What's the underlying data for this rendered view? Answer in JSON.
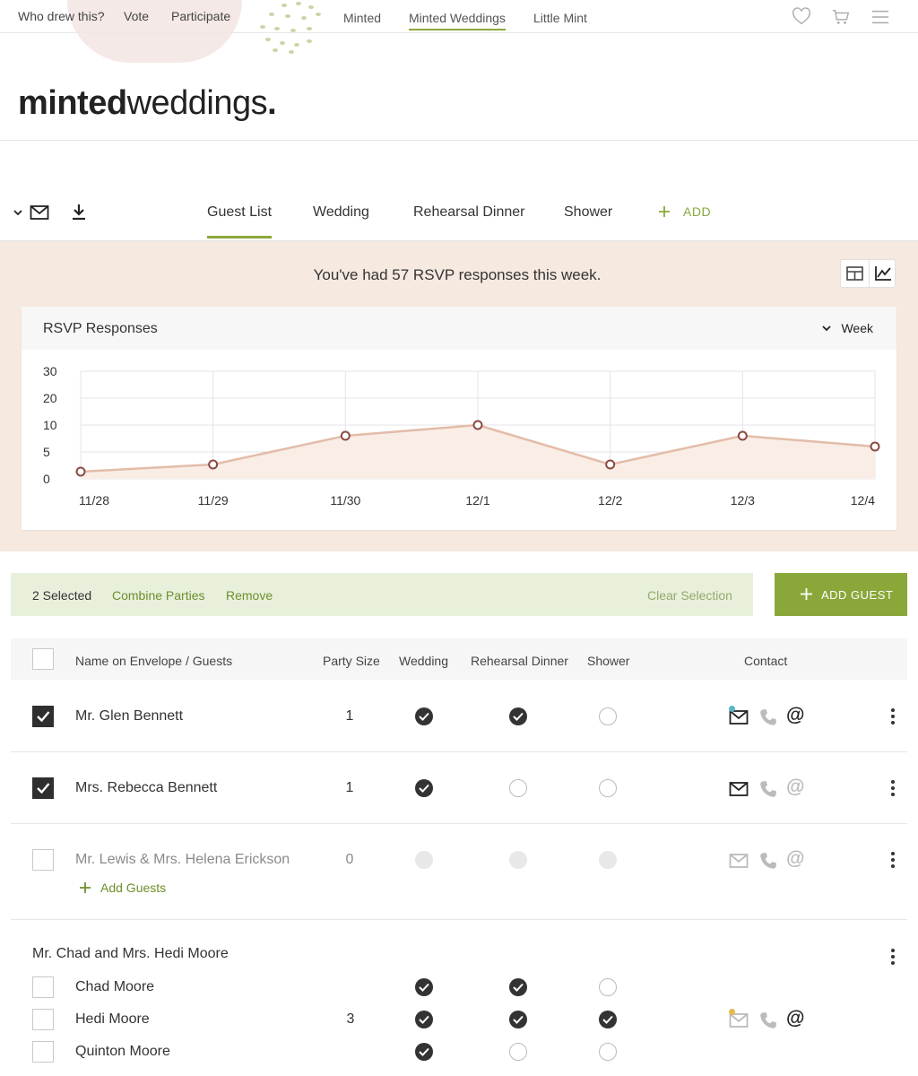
{
  "topbar": {
    "left_links": [
      "Who drew this?",
      "Vote",
      "Participate"
    ],
    "center_links": [
      "Minted",
      "Minted Weddings",
      "Little Mint"
    ],
    "active_center": "Minted Weddings",
    "icons": [
      "heart-icon",
      "cart-icon",
      "menu-icon"
    ]
  },
  "logo": {
    "bold": "minted",
    "regular": "weddings",
    "dot": "."
  },
  "toolbar": {
    "icons": [
      "chevron-down-icon",
      "mail-icon",
      "download-icon"
    ]
  },
  "tabs": {
    "items": [
      "Guest List",
      "Wedding",
      "Rehearsal Dinner",
      "Shower"
    ],
    "active": "Guest List",
    "add_label": "ADD"
  },
  "summary": {
    "message": "You've had 57 RSVP responses this week."
  },
  "chart_card": {
    "title": "RSVP Responses",
    "range_label": "Week"
  },
  "chart_data": {
    "type": "line",
    "title": "RSVP Responses",
    "x": [
      "11/28",
      "11/29",
      "11/30",
      "12/1",
      "12/2",
      "12/3",
      "12/4"
    ],
    "values": [
      2,
      4,
      12,
      15,
      4,
      12,
      9
    ],
    "y_ticks": [
      "30",
      "20",
      "10",
      "5",
      "0"
    ],
    "ylim": [
      0,
      30
    ],
    "grid": true,
    "colors": {
      "line": "#e3bca8",
      "fill": "#f9ede6",
      "point": "#8a4a44"
    }
  },
  "selection_bar": {
    "count_label": "2 Selected",
    "combine": "Combine Parties",
    "remove": "Remove",
    "clear": "Clear Selection"
  },
  "add_guest_button": "ADD GUEST",
  "table": {
    "headers": [
      "Name on Envelope / Guests",
      "Party Size",
      "Wedding",
      "Rehearsal Dinner",
      "Shower",
      "Contact"
    ],
    "rows": [
      {
        "name": "Mr. Glen Bennett",
        "party": "1",
        "checked": true,
        "wedding": "yes",
        "rehearsal": "yes",
        "shower": "no"
      },
      {
        "name": "Mrs. Rebecca Bennett",
        "party": "1",
        "checked": true,
        "wedding": "yes",
        "rehearsal": "no",
        "shower": "no"
      },
      {
        "name": "Mr. Lewis & Mrs. Helena Erickson",
        "party": "0",
        "checked": false,
        "wedding": "na",
        "rehearsal": "na",
        "shower": "na",
        "add_guests": "Add Guests"
      }
    ],
    "party_group": {
      "name": "Mr. Chad and Mrs. Hedi Moore",
      "party": "3",
      "members": [
        {
          "name": "Chad Moore",
          "wedding": "yes",
          "rehearsal": "yes",
          "shower": "no"
        },
        {
          "name": "Hedi Moore",
          "wedding": "yes",
          "rehearsal": "yes",
          "shower": "yes"
        },
        {
          "name": "Quinton Moore",
          "wedding": "yes",
          "rehearsal": "no",
          "shower": "no"
        }
      ]
    }
  },
  "colors": {
    "accent": "#8aa83a",
    "peach": "#f5e9e0",
    "selbar": "#e8f0dc"
  }
}
